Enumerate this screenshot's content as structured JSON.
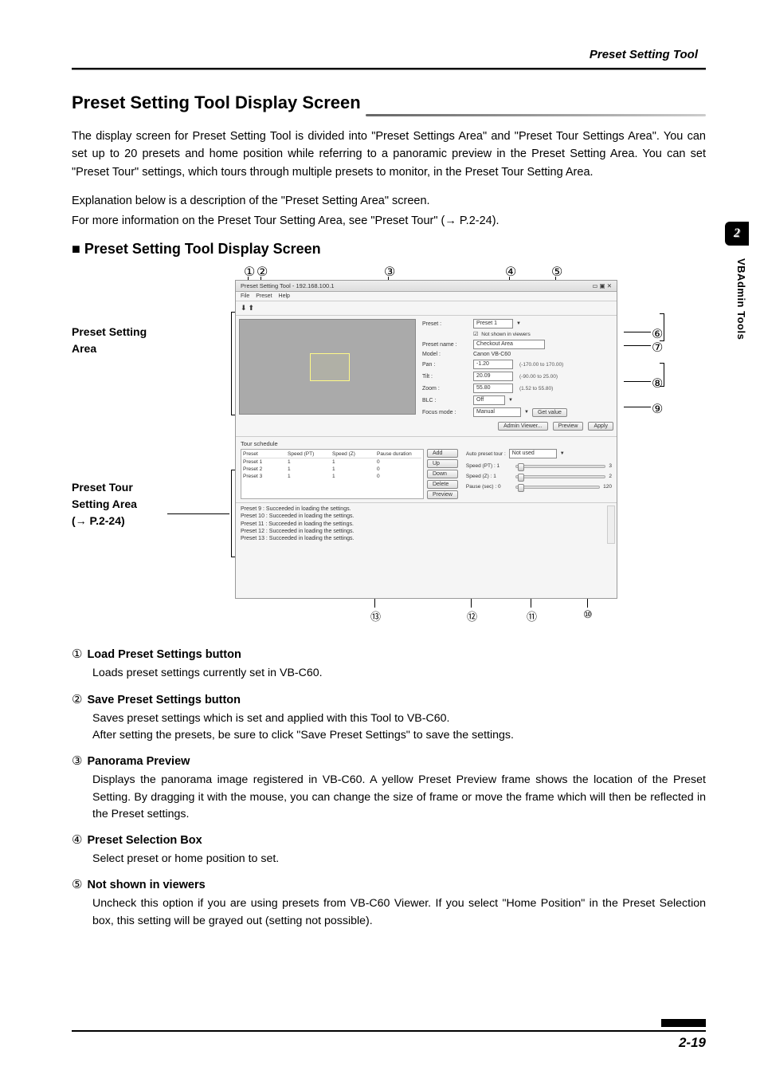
{
  "header": {
    "title": "Preset Setting Tool"
  },
  "section": {
    "title": "Preset Setting Tool Display Screen"
  },
  "intro": {
    "p1": "The display screen for Preset Setting Tool is divided into \"Preset Settings Area\" and \"Preset Tour Settings Area\". You can set up to 20 presets and home position while referring to a panoramic preview in the Preset Setting Area. You can set \"Preset Tour\" settings, which tours through multiple presets to monitor, in the Preset Tour Setting Area.",
    "p2": "Explanation below is a description of the \"Preset Setting Area\" screen.",
    "p3": "For more information on the Preset Tour Setting Area, see \"Preset Tour\" (→ P.2-24)."
  },
  "subheading": "Preset Setting Tool Display Screen",
  "figure": {
    "left_label1_a": "Preset Setting",
    "left_label1_b": "Area",
    "left_label2_a": "Preset Tour",
    "left_label2_b": "Setting Area",
    "left_label2_c": "(→ P.2-24)",
    "callouts": {
      "c1": "①",
      "c2": "②",
      "c3": "③",
      "c4": "④",
      "c5": "⑤",
      "c6": "⑥",
      "c7": "⑦",
      "c8": "⑧",
      "c9": "⑨",
      "c10": "⑩",
      "c11": "⑪",
      "c12": "⑫",
      "c13": "⑬"
    }
  },
  "screenshot": {
    "window_title": "Preset Setting Tool - 192.168.100.1",
    "menu": {
      "file": "File",
      "preset": "Preset",
      "help": "Help"
    },
    "fields": {
      "preset_label": "Preset :",
      "preset_value": "Preset 1",
      "notshown_label": "Not shown in viewers",
      "presetname_label": "Preset name :",
      "presetname_value": "Checkout Area",
      "model_label": "Model :",
      "model_value": "Canon VB-C60",
      "pan_label": "Pan :",
      "pan_value": "-1.20",
      "pan_range": "(-170.00 to 170.00)",
      "tilt_label": "Tilt :",
      "tilt_value": "20.09",
      "tilt_range": "(-90.00 to 25.00)",
      "zoom_label": "Zoom :",
      "zoom_value": "55.80",
      "zoom_range": "(1.52 to 55.80)",
      "blc_label": "BLC :",
      "blc_value": "Off",
      "focus_label": "Focus mode :",
      "focus_value": "Manual",
      "getvalue_btn": "Get value",
      "adminviewer_btn": "Admin Viewer...",
      "preview_btn": "Preview",
      "apply_btn": "Apply"
    },
    "tour": {
      "title": "Tour schedule",
      "cols": {
        "preset": "Preset",
        "spt": "Speed (PT)",
        "sz": "Speed (Z)",
        "pd": "Pause duration"
      },
      "rows": [
        {
          "p": "Preset 1",
          "a": "1",
          "b": "1",
          "c": "0"
        },
        {
          "p": "Preset 2",
          "a": "1",
          "b": "1",
          "c": "0"
        },
        {
          "p": "Preset 3",
          "a": "1",
          "b": "1",
          "c": "0"
        }
      ],
      "btns": {
        "add": "Add",
        "up": "Up",
        "down": "Down",
        "delete": "Delete",
        "preview": "Preview"
      },
      "auto_label": "Auto preset tour :",
      "auto_value": "Not used",
      "speedpt_label": "Speed (PT) :  1",
      "speedpt_max": "3",
      "speedz_label": "Speed (Z) :    1",
      "speedz_max": "2",
      "pause_label": "Pause (sec) :  0",
      "pause_max": "120"
    },
    "log": [
      "Preset 9 : Succeeded in loading the settings.",
      "Preset 10 : Succeeded in loading the settings.",
      "Preset 11 : Succeeded in loading the settings.",
      "Preset 12 : Succeeded in loading the settings.",
      "Preset 13 : Succeeded in loading the settings."
    ]
  },
  "items": [
    {
      "num": "①",
      "title": "Load Preset Settings button",
      "body": "Loads preset settings currently set in VB-C60."
    },
    {
      "num": "②",
      "title": "Save Preset Settings button",
      "body": "Saves preset settings which is set and applied with this Tool to VB-C60.\nAfter setting the presets, be sure to click \"Save Preset Settings\" to save the settings."
    },
    {
      "num": "③",
      "title": "Panorama Preview",
      "body": "Displays the panorama image registered in VB-C60. A yellow Preset Preview frame shows the location of the Preset Setting. By dragging it with the mouse, you can change the size of frame or move the frame which will then be reflected in the Preset settings."
    },
    {
      "num": "④",
      "title": "Preset Selection Box",
      "body": "Select preset or home position to set."
    },
    {
      "num": "⑤",
      "title": "Not shown in viewers",
      "body": "Uncheck this option if you are using presets from VB-C60 Viewer. If you select \"Home Position\" in the Preset Selection box, this setting will be grayed out (setting not possible)."
    }
  ],
  "sidetab": {
    "num": "2",
    "text": "VBAdmin Tools"
  },
  "page_num": "2-19"
}
